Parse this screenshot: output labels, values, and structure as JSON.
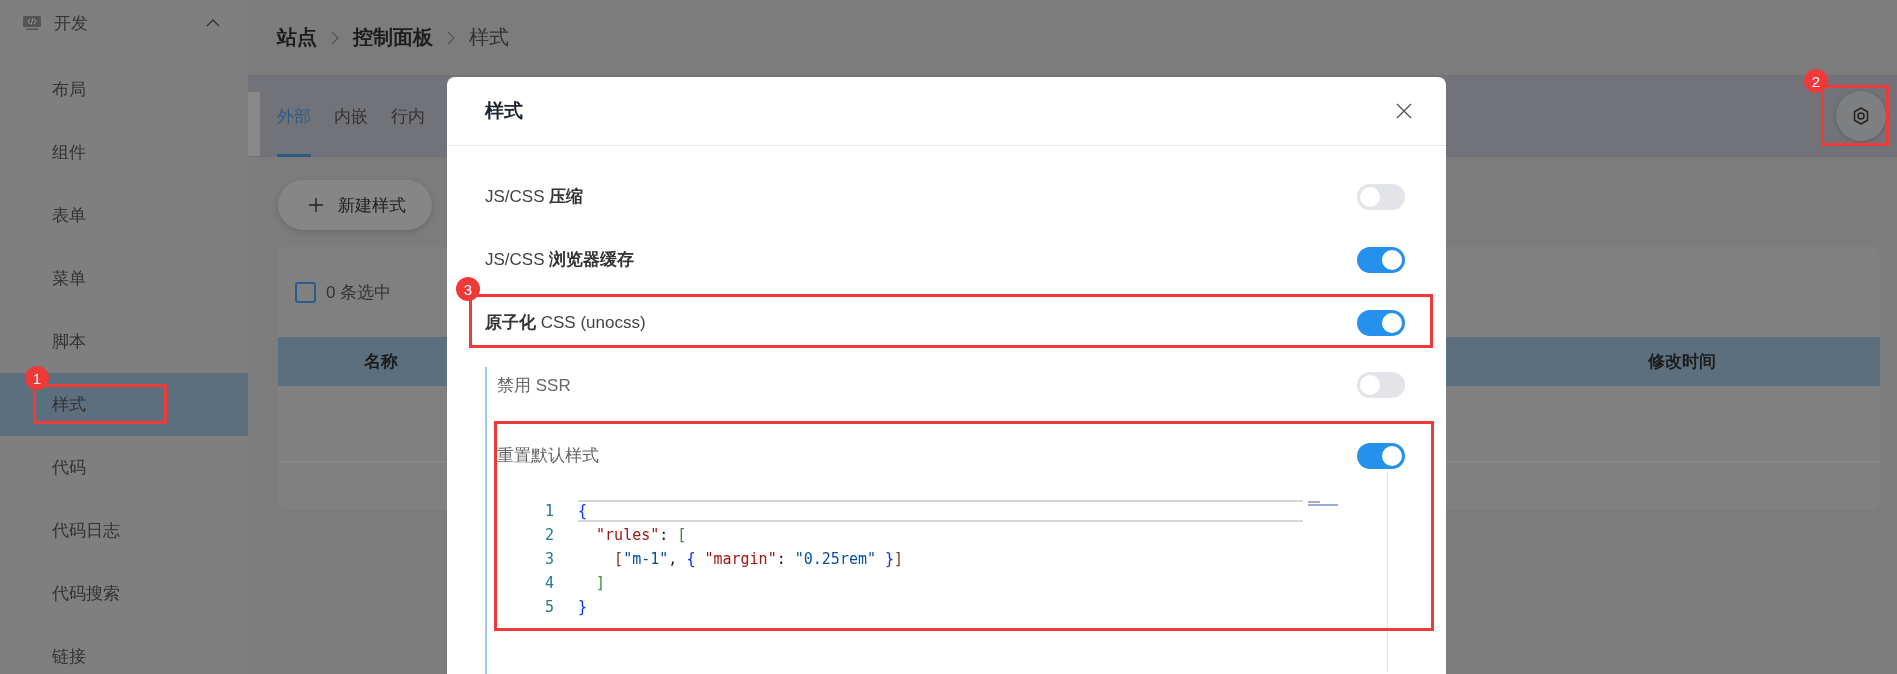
{
  "sidebar": {
    "group": {
      "label": "开发",
      "expanded": true
    },
    "items": [
      {
        "label": "布局",
        "selected": false
      },
      {
        "label": "组件",
        "selected": false
      },
      {
        "label": "表单",
        "selected": false
      },
      {
        "label": "菜单",
        "selected": false
      },
      {
        "label": "脚本",
        "selected": false
      },
      {
        "label": "样式",
        "selected": true,
        "annotation": "1"
      },
      {
        "label": "代码",
        "selected": false
      },
      {
        "label": "代码日志",
        "selected": false
      },
      {
        "label": "代码搜索",
        "selected": false
      },
      {
        "label": "链接",
        "selected": false
      }
    ]
  },
  "breadcrumb": [
    {
      "label": "站点",
      "current": false
    },
    {
      "label": "控制面板",
      "current": false
    },
    {
      "label": "样式",
      "current": true
    }
  ],
  "tabs": [
    {
      "label": "外部",
      "selected": true
    },
    {
      "label": "内嵌",
      "selected": false
    },
    {
      "label": "行内",
      "selected": false
    }
  ],
  "settings_button": {
    "annotation": "2"
  },
  "new_button": {
    "label": "新建样式"
  },
  "table": {
    "selection": {
      "checked": false,
      "label": "0 条选中"
    },
    "columns": [
      "名称",
      "修改时间"
    ]
  },
  "dialog": {
    "title": "样式",
    "rows": [
      {
        "label": "JS/CSS **压缩**",
        "on": false
      },
      {
        "label": "JS/CSS **浏览器缓存**",
        "on": true
      },
      {
        "label": "**原子化** CSS (unocss)",
        "on": true,
        "annotation": "3",
        "children": [
          {
            "label": "禁用 SSR",
            "on": false,
            "annotated": false
          },
          {
            "label": "重置默认样式",
            "on": true,
            "annotated": true,
            "code": [
              {
                "number": "1",
                "current": true,
                "tokens": [
                  {
                    "text": "{",
                    "kind": "bracket1"
                  }
                ]
              },
              {
                "number": "2",
                "current": false,
                "tokens": [
                  {
                    "text": "  \"rules\"",
                    "kind": "key"
                  },
                  {
                    "text": ": ",
                    "kind": "plain"
                  },
                  {
                    "text": "[",
                    "kind": "bracket2"
                  }
                ]
              },
              {
                "number": "3",
                "current": false,
                "tokens": [
                  {
                    "text": "    [",
                    "kind": "bracket3"
                  },
                  {
                    "text": "\"m-1\"",
                    "kind": "string"
                  },
                  {
                    "text": ", ",
                    "kind": "plain"
                  },
                  {
                    "text": "{",
                    "kind": "bracket1"
                  },
                  {
                    "text": " \"margin\"",
                    "kind": "key"
                  },
                  {
                    "text": ": ",
                    "kind": "plain"
                  },
                  {
                    "text": "\"0.25rem\"",
                    "kind": "string"
                  },
                  {
                    "text": " }",
                    "kind": "bracket1"
                  },
                  {
                    "text": "]",
                    "kind": "bracket3"
                  }
                ]
              },
              {
                "number": "4",
                "current": false,
                "tokens": [
                  {
                    "text": "  ]",
                    "kind": "bracket2"
                  }
                ]
              },
              {
                "number": "5",
                "current": false,
                "tokens": [
                  {
                    "text": "}",
                    "kind": "bracket1"
                  }
                ]
              }
            ]
          }
        ]
      }
    ]
  }
}
